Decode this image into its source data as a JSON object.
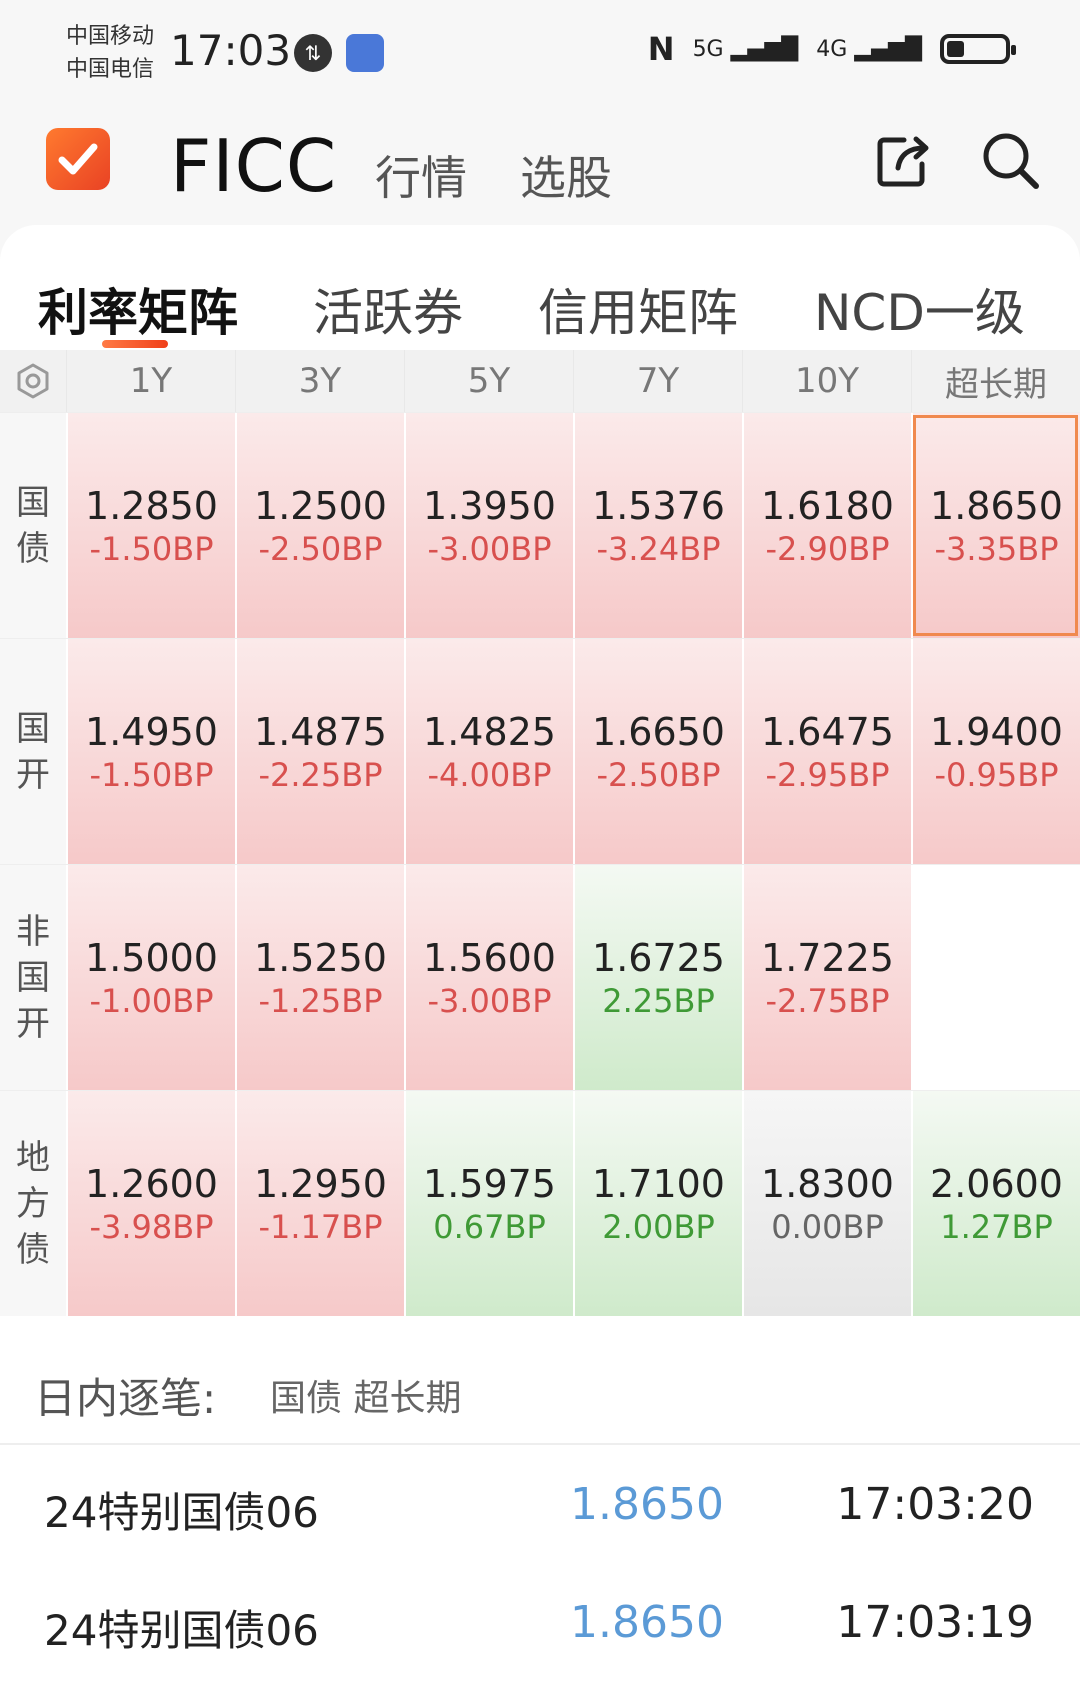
{
  "status_bar": {
    "carrier_1": "中国移动",
    "carrier_2": "中国电信",
    "time": "17:03",
    "signal_1": "5G",
    "signal_2": "4G",
    "battery_level": 0.28
  },
  "header": {
    "app_title": "FICC",
    "tabs": [
      "行情",
      "选股"
    ]
  },
  "matrix_tabs": [
    "利率矩阵",
    "活跃券",
    "信用矩阵",
    "NCD一级"
  ],
  "matrix": {
    "columns": [
      "1Y",
      "3Y",
      "5Y",
      "7Y",
      "10Y",
      "超长期"
    ],
    "rows": [
      {
        "label": "国债",
        "cells": [
          {
            "yield": "1.2850",
            "change": "-1.50BP",
            "dir": "down"
          },
          {
            "yield": "1.2500",
            "change": "-2.50BP",
            "dir": "down"
          },
          {
            "yield": "1.3950",
            "change": "-3.00BP",
            "dir": "down"
          },
          {
            "yield": "1.5376",
            "change": "-3.24BP",
            "dir": "down"
          },
          {
            "yield": "1.6180",
            "change": "-2.90BP",
            "dir": "down"
          },
          {
            "yield": "1.8650",
            "change": "-3.35BP",
            "dir": "down",
            "selected": true
          }
        ]
      },
      {
        "label": "国开",
        "cells": [
          {
            "yield": "1.4950",
            "change": "-1.50BP",
            "dir": "down"
          },
          {
            "yield": "1.4875",
            "change": "-2.25BP",
            "dir": "down"
          },
          {
            "yield": "1.4825",
            "change": "-4.00BP",
            "dir": "down"
          },
          {
            "yield": "1.6650",
            "change": "-2.50BP",
            "dir": "down"
          },
          {
            "yield": "1.6475",
            "change": "-2.95BP",
            "dir": "down"
          },
          {
            "yield": "1.9400",
            "change": "-0.95BP",
            "dir": "down"
          }
        ]
      },
      {
        "label": "非国开",
        "cells": [
          {
            "yield": "1.5000",
            "change": "-1.00BP",
            "dir": "down"
          },
          {
            "yield": "1.5250",
            "change": "-1.25BP",
            "dir": "down"
          },
          {
            "yield": "1.5600",
            "change": "-3.00BP",
            "dir": "down"
          },
          {
            "yield": "1.6725",
            "change": "2.25BP",
            "dir": "up"
          },
          {
            "yield": "1.7225",
            "change": "-2.75BP",
            "dir": "down"
          },
          {
            "yield": "",
            "change": "",
            "dir": "empty"
          }
        ]
      },
      {
        "label": "地方债",
        "cells": [
          {
            "yield": "1.2600",
            "change": "-3.98BP",
            "dir": "down"
          },
          {
            "yield": "1.2950",
            "change": "-1.17BP",
            "dir": "down"
          },
          {
            "yield": "1.5975",
            "change": "0.67BP",
            "dir": "up"
          },
          {
            "yield": "1.7100",
            "change": "2.00BP",
            "dir": "up"
          },
          {
            "yield": "1.8300",
            "change": "0.00BP",
            "dir": "flat"
          },
          {
            "yield": "2.0600",
            "change": "1.27BP",
            "dir": "up"
          }
        ]
      }
    ]
  },
  "ticks": {
    "title": "日内逐笔:",
    "filter": "国债 超长期",
    "rows": [
      {
        "name": "24特别国债06",
        "price": "1.8650",
        "time": "17:03:20"
      },
      {
        "name": "24特别国债06",
        "price": "1.8650",
        "time": "17:03:19"
      }
    ]
  },
  "colors": {
    "accent": "#f0401a",
    "down_text": "#d8504e",
    "up_text": "#3f9a36",
    "tick_price": "#5b9ad6"
  }
}
